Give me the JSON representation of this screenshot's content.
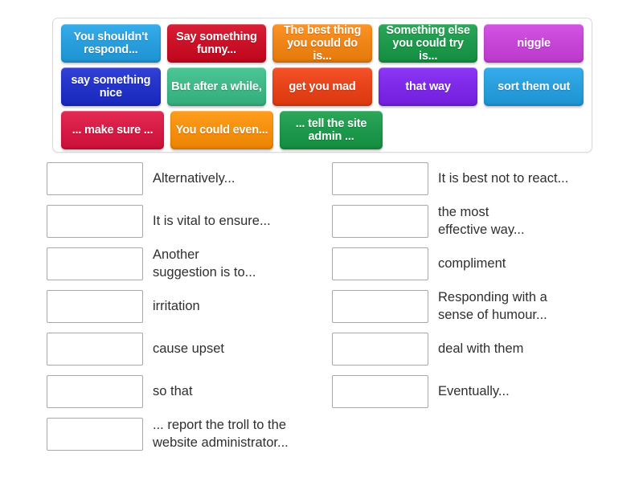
{
  "tile_bank": {
    "name": "draggable-answer-tiles",
    "rows": [
      [
        {
          "label": "You shouldn't\nrespond...",
          "color": "#2a9fdd"
        },
        {
          "label": "Say something\nfunny...",
          "color": "#cb1228"
        },
        {
          "label": "The best thing\nyou could do is...",
          "color": "#f08518"
        },
        {
          "label": "Something else\nyou could try is...",
          "color": "#1f9a4d"
        },
        {
          "label": "niggle",
          "color": "#c746d8"
        }
      ],
      [
        {
          "label": "say something\nnice",
          "color": "#2434c9"
        },
        {
          "label": "But after\na while,",
          "color": "#3fb987"
        },
        {
          "label": "get you mad",
          "color": "#e8441b"
        },
        {
          "label": "that way",
          "color": "#7f2ae8"
        },
        {
          "label": "sort them out",
          "color": "#2a9fdd"
        }
      ],
      [
        {
          "label": "... make\nsure ...",
          "color": "#d71c45"
        },
        {
          "label": "You could\neven...",
          "color": "#f7900f"
        },
        {
          "label": "... tell the\nsite admin ...",
          "color": "#1f9a4d"
        }
      ]
    ]
  },
  "answers": {
    "left_column": [
      {
        "box_value": "",
        "text": "Alternatively..."
      },
      {
        "box_value": "",
        "text": "It is vital to ensure..."
      },
      {
        "box_value": "",
        "text": "Another\nsuggestion is to..."
      },
      {
        "box_value": "",
        "text": "irritation"
      },
      {
        "box_value": "",
        "text": "cause upset"
      },
      {
        "box_value": "",
        "text": "so that"
      },
      {
        "box_value": "",
        "text": "... report the troll to the\nwebsite administrator..."
      }
    ],
    "right_column": [
      {
        "box_value": "",
        "text": "It is best not to react..."
      },
      {
        "box_value": "",
        "text": "the most\neffective way..."
      },
      {
        "box_value": "",
        "text": "compliment"
      },
      {
        "box_value": "",
        "text": "Responding with a\nsense of humour..."
      },
      {
        "box_value": "",
        "text": "deal with them"
      },
      {
        "box_value": "",
        "text": "Eventually..."
      }
    ]
  },
  "colors": {
    "page_background": "#ffffff",
    "panel_border": "#d9d9d9",
    "dropbox_border": "#a8a8a8",
    "text": "#2f2f2f"
  }
}
